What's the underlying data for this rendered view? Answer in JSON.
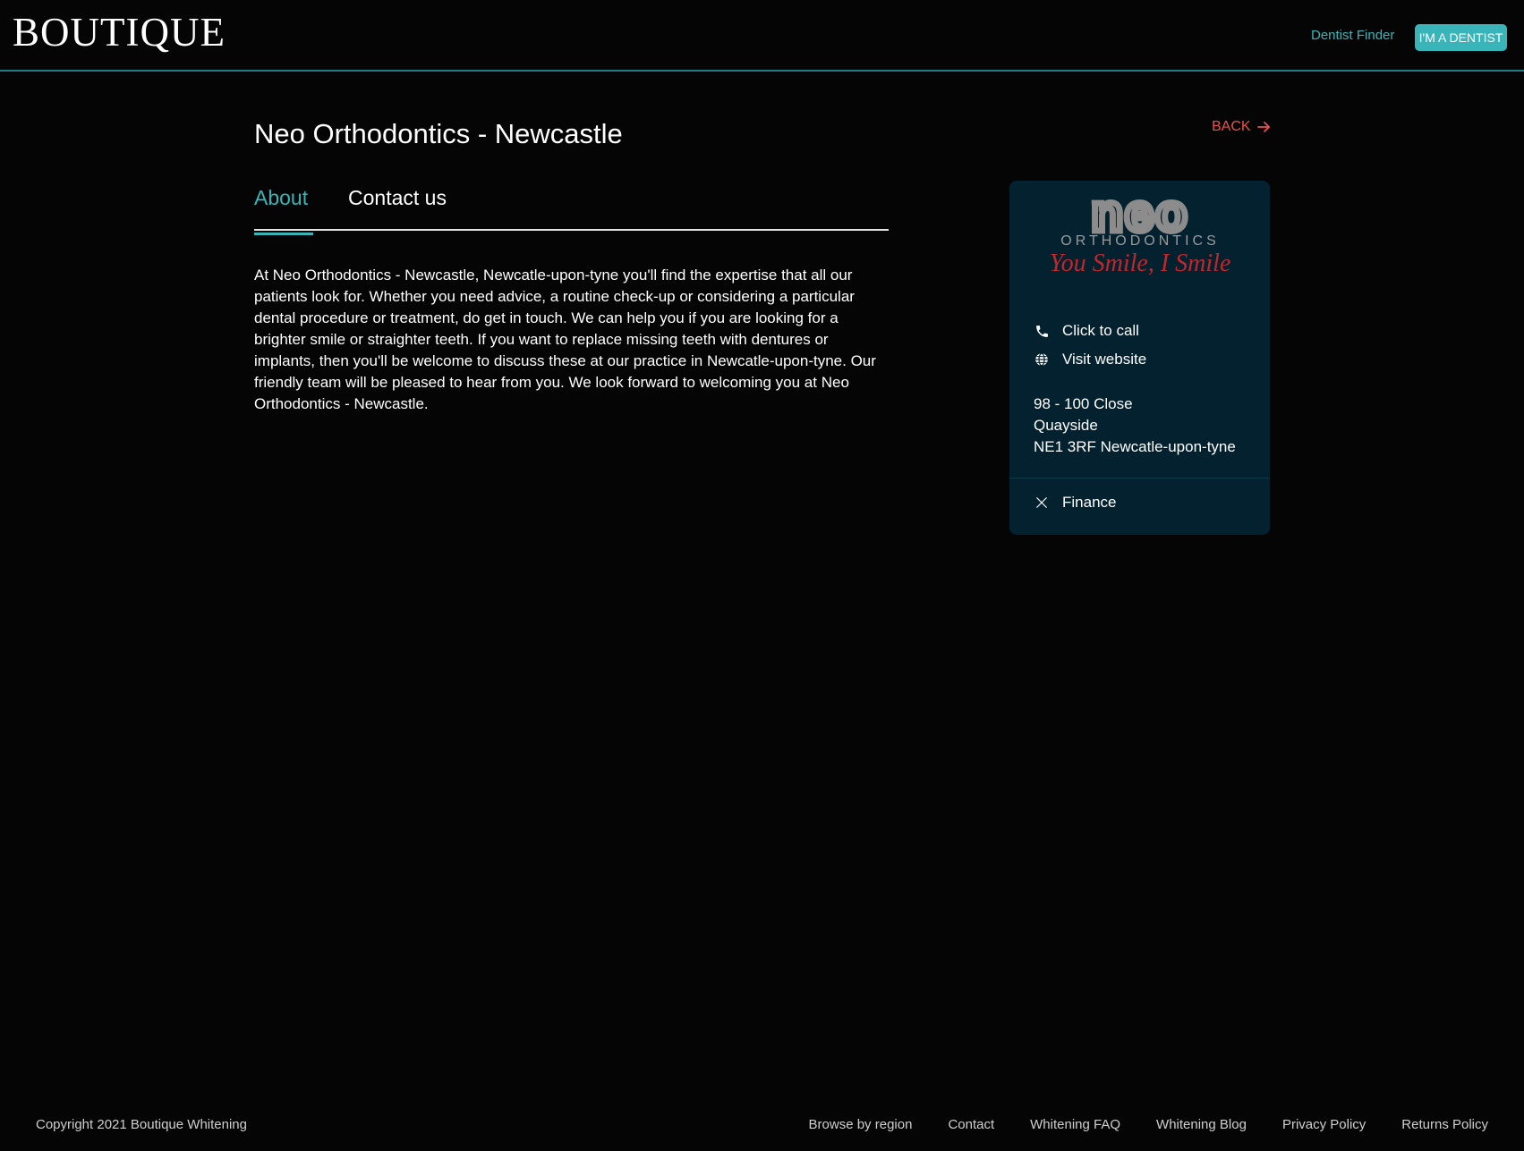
{
  "header": {
    "logo": "BOUTIQUE",
    "nav_link": "Dentist Finder",
    "dentist_button": "I'M A DENTIST"
  },
  "page": {
    "title": "Neo Orthodontics - Newcastle",
    "back_label": "BACK"
  },
  "tabs": [
    {
      "label": "About",
      "active": true
    },
    {
      "label": "Contact us",
      "active": false
    }
  ],
  "about": {
    "text": "At Neo Orthodontics - Newcastle, Newcatle-upon-tyne you'll find the expertise that all our patients look for. Whether you need advice, a routine check-up or considering a particular dental procedure or treatment, do get in touch. We can help you if you are looking for a brighter smile or straighter teeth. If you want to replace missing teeth with dentures or implants, then you'll be welcome to discuss these at our practice in Newcatle-upon-tyne. Our friendly team will be pleased to hear from you. We look forward to welcoming you at Neo Orthodontics - Newcastle."
  },
  "card": {
    "logo_main": "neo",
    "logo_sub": "ORTHODONTICS",
    "logo_tagline": "You Smile, I Smile",
    "call_label": "Click to call",
    "website_label": "Visit website",
    "address": {
      "line1": "98 - 100 Close",
      "line2": "Quayside",
      "line3": "NE1 3RF Newcatle-upon-tyne"
    },
    "finance_label": "Finance",
    "finance_icon": "close-icon"
  },
  "footer": {
    "copyright": "Copyright 2021 Boutique Whitening",
    "links": [
      "Browse by region",
      "Contact",
      "Whitening FAQ",
      "Whitening Blog",
      "Privacy Policy",
      "Returns Policy"
    ]
  },
  "colors": {
    "accent": "#39b5b9",
    "back": "#e8524f",
    "card_bg": "#03212f",
    "background": "#050505"
  }
}
